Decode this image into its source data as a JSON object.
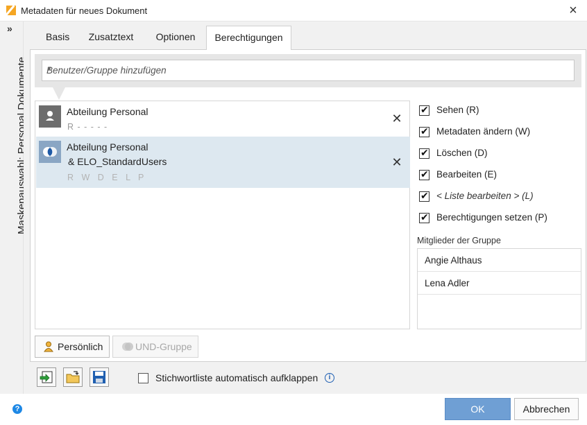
{
  "window": {
    "title": "Metadaten für neues Dokument"
  },
  "sidebar": {
    "label": "Maskenauswahl: Personal Dokumente"
  },
  "tabs": [
    {
      "label": "Basis"
    },
    {
      "label": "Zusatztext"
    },
    {
      "label": "Optionen"
    },
    {
      "label": "Berechtigungen",
      "active": true
    }
  ],
  "add_user": {
    "placeholder": "Benutzer/Gruppe hinzufügen"
  },
  "entries": [
    {
      "name": "Abteilung Personal",
      "rights": "R - - - - -",
      "icon": "user-icon"
    },
    {
      "name_line1": "Abteilung Personal",
      "name_line2": "& ELO_StandardUsers",
      "rights": "R W D E L P",
      "icon": "and-group-icon",
      "selected": true
    }
  ],
  "permissions": [
    {
      "label": "Sehen (R)",
      "checked": true
    },
    {
      "label": "Metadaten ändern (W)",
      "checked": true
    },
    {
      "label": "Löschen (D)",
      "checked": true
    },
    {
      "label": "Bearbeiten (E)",
      "checked": true
    },
    {
      "label": "< Liste bearbeiten > (L)",
      "checked": true
    },
    {
      "label": "Berechtigungen setzen (P)",
      "checked": true
    }
  ],
  "members": {
    "title": "Mitglieder der Gruppe",
    "items": [
      "Angie Althaus",
      "Lena Adler"
    ]
  },
  "buttons": {
    "personal": "Persönlich",
    "and_group": "UND-Gruppe",
    "ok": "OK",
    "cancel": "Abbrechen"
  },
  "options": {
    "auto_expand_label": "Stichwortliste automatisch aufklappen"
  },
  "colors": {
    "accent": "#6f9fd4",
    "selection": "#dde8f0",
    "brand": "#f5a623"
  }
}
